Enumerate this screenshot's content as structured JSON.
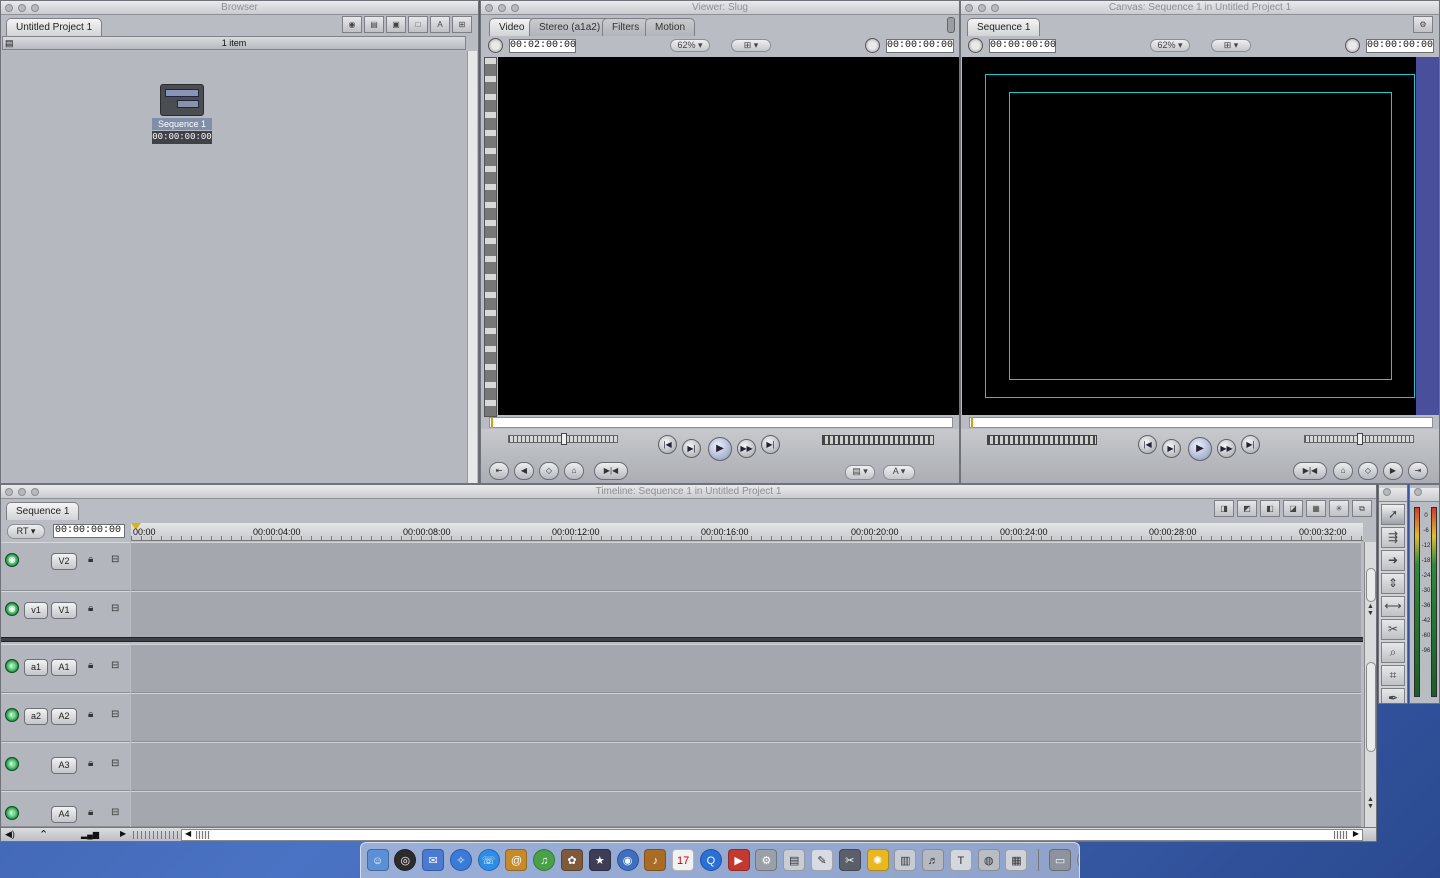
{
  "browser": {
    "title": "Browser",
    "tab": "Untitled Project 1",
    "item_count": "1 item",
    "sequence": {
      "name": "Sequence 1",
      "duration": "00:00:00:00"
    }
  },
  "viewer": {
    "title": "Viewer: Slug",
    "tabs": [
      "Video",
      "Stereo (a1a2)",
      "Filters",
      "Motion"
    ],
    "duration": "00:02:00:00",
    "zoom": "62%",
    "timecode": "00:00:00:00"
  },
  "canvas": {
    "title": "Canvas: Sequence 1 in Untitled Project 1",
    "tab": "Sequence 1",
    "duration": "00:00:00:00",
    "zoom": "62%",
    "timecode": "00:00:00:00",
    "safe_color": "#22c6cf",
    "side_color": "#4a4f9c"
  },
  "timeline": {
    "title": "Timeline: Sequence 1 in Untitled Project 1",
    "tab": "Sequence 1",
    "rt": "RT",
    "timecode": "00:00:00:00",
    "ruler": [
      "00:00",
      "00:00:04:00",
      "00:00:08:00",
      "00:00:12:00",
      "00:00:16:00",
      "00:00:20:00",
      "00:00:24:00",
      "00:00:28:00",
      "00:00:32:00"
    ],
    "tracks": [
      {
        "src": "",
        "dst": "V2"
      },
      {
        "src": "v1",
        "dst": "V1"
      },
      {
        "src": "a1",
        "dst": "A1"
      },
      {
        "src": "a2",
        "dst": "A2"
      },
      {
        "src": "",
        "dst": "A3"
      },
      {
        "src": "",
        "dst": "A4"
      }
    ]
  },
  "meters": {
    "labels": [
      "0",
      "-6",
      "-12",
      "-18",
      "-24",
      "-30",
      "-36",
      "-42",
      "-60",
      "-96"
    ]
  },
  "dock": {
    "calendar_day": "17"
  }
}
